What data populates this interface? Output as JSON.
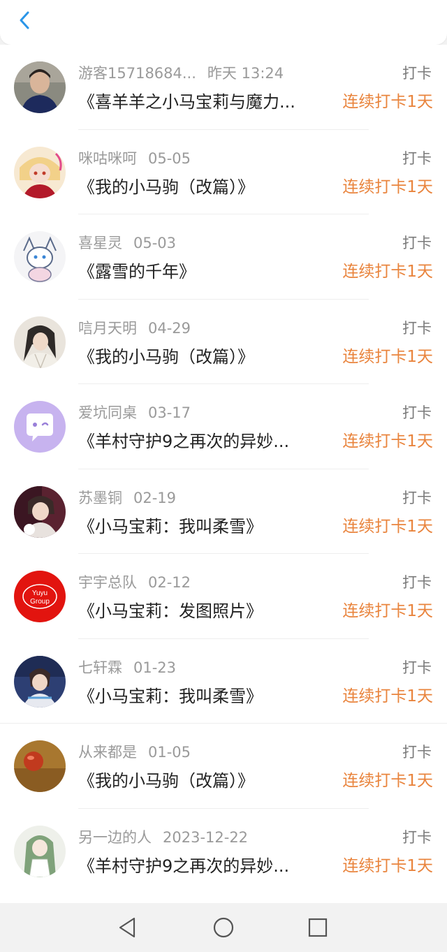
{
  "header": {
    "back_icon": "chevron-left-icon",
    "accent_color": "#2a95e8"
  },
  "items": [
    {
      "name": "游客15718684...",
      "date": "昨天 13:24",
      "label": "打卡",
      "title": "《喜羊羊之小马宝莉与魔力...",
      "streak": "连续打卡1天",
      "avatar": "portrait-boy-avatar"
    },
    {
      "name": "咪咕咪呵",
      "date": "05-05",
      "label": "打卡",
      "title": "《我的小马驹（改篇）》",
      "streak": "连续打卡1天",
      "avatar": "anime-girl-avatar"
    },
    {
      "name": "喜星灵",
      "date": "05-03",
      "label": "打卡",
      "title": "《露雪的千年》",
      "streak": "连续打卡1天",
      "avatar": "sketch-character-avatar"
    },
    {
      "name": "唁月天明",
      "date": "04-29",
      "label": "打卡",
      "title": "《我的小马驹（改篇）》",
      "streak": "连续打卡1天",
      "avatar": "ancient-style-avatar"
    },
    {
      "name": "爱坑同桌",
      "date": "03-17",
      "label": "打卡",
      "title": "《羊村守护9之再次的异妙...",
      "streak": "连续打卡1天",
      "avatar": "chat-bubble-avatar"
    },
    {
      "name": "苏墨铜",
      "date": "02-19",
      "label": "打卡",
      "title": "《小马宝莉：我叫柔雪》",
      "streak": "连续打卡1天",
      "avatar": "anime-boy-avatar"
    },
    {
      "name": "宇宇总队",
      "date": "02-12",
      "label": "打卡",
      "title": "《小马宝莉：发图照片》",
      "streak": "连续打卡1天",
      "avatar": "yuyu-group-logo-avatar",
      "avatar_text": "Yuyu Group"
    },
    {
      "name": "七轩霖",
      "date": "01-23",
      "label": "打卡",
      "title": "《小马宝莉：我叫柔雪》",
      "streak": "连续打卡1天",
      "avatar": "anime-blue-avatar"
    },
    {
      "name": "从来都是",
      "date": "01-05",
      "label": "打卡",
      "title": "《我的小马驹（改篇）》",
      "streak": "连续打卡1天",
      "avatar": "brown-ball-avatar"
    },
    {
      "name": "另一边的人",
      "date": "2023-12-22",
      "label": "打卡",
      "title": "《羊村守护9之再次的异妙...",
      "streak": "连续打卡1天",
      "avatar": "green-hair-avatar"
    }
  ],
  "navbar": {
    "back": "triangle-back-icon",
    "home": "circle-home-icon",
    "recents": "square-recents-icon"
  },
  "colors": {
    "streak": "#e9843d",
    "meta": "#9a9a9a",
    "title": "#222222"
  }
}
